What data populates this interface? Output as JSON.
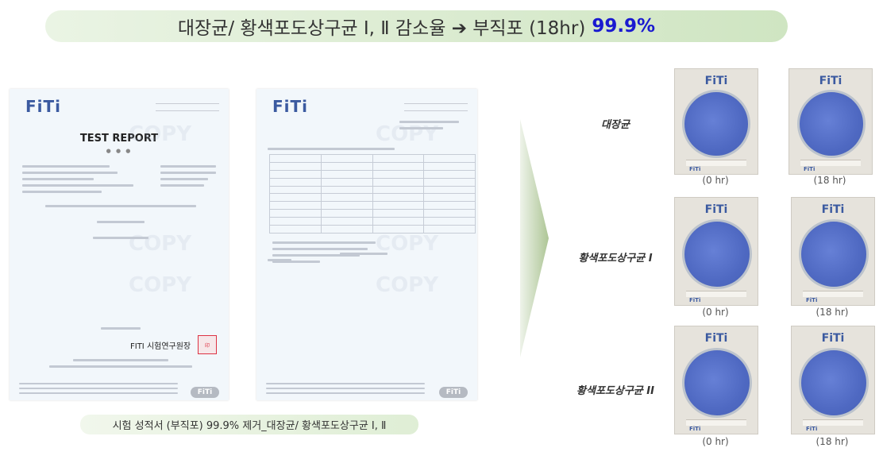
{
  "banner": {
    "text": "대장균/ 황색포도상구균 Ⅰ, Ⅱ 감소율 ➔ 부직포 (18hr)",
    "highlight": "99.9%"
  },
  "doc1": {
    "logo": "FiTi",
    "title": "TEST REPORT",
    "signature": "FITI 시험연구원장",
    "stamp": "印",
    "watermark": "COPY",
    "footer_logo": "FiTi"
  },
  "doc2": {
    "logo": "FiTi",
    "watermark": "COPY",
    "footer_logo": "FiTi"
  },
  "caption": "시험 성적서 (부직포) 99.9% 제거_대장균/ 황색포도상구균 Ⅰ, Ⅱ",
  "rows": [
    {
      "label": "대장균",
      "t0": "(0 hr)",
      "t18": "(18 hr)"
    },
    {
      "label": "황색포도상구균 I",
      "t0": "(0 hr)",
      "t18": "(18 hr)"
    },
    {
      "label": "황색포도상구균 II",
      "t0": "(0 hr)",
      "t18": "(18 hr)"
    }
  ],
  "dish_logo": "FiTi",
  "colors": {
    "accent": "#1a1ad0",
    "banner_bg": "#dcecd2",
    "plate": "#4f69c2"
  }
}
